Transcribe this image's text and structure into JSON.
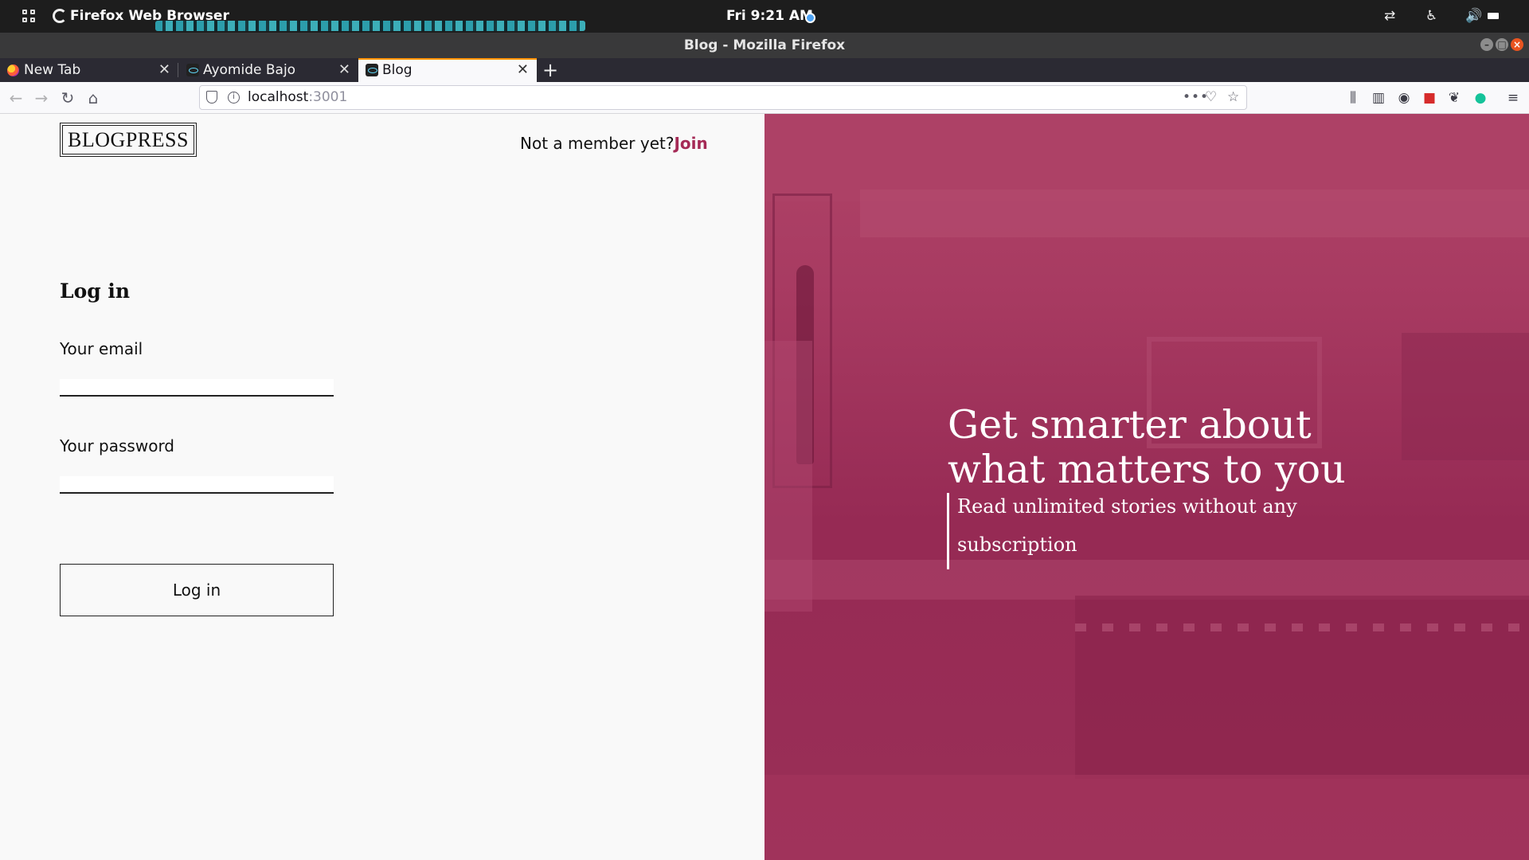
{
  "system": {
    "app_name": "Firefox Web Browser",
    "clock": "Fri  9:21 AM"
  },
  "window": {
    "title": "Blog - Mozilla Firefox"
  },
  "tabs": [
    {
      "label": "New Tab",
      "icon": "firefox-icon",
      "active": false
    },
    {
      "label": "Ayomide Bajo",
      "icon": "react-icon",
      "active": false
    },
    {
      "label": "Blog",
      "icon": "react-icon",
      "active": true
    }
  ],
  "urlbar": {
    "host": "localhost",
    "port": ":3001"
  },
  "header": {
    "logo": "BLOGPRESS",
    "member_prompt": "Not a member yet?",
    "join_link": "Join"
  },
  "form": {
    "title": "Log in",
    "email_label": "Your email",
    "email_value": "",
    "password_label": "Your password",
    "password_value": "",
    "submit_label": "Log in"
  },
  "hero": {
    "headline": "Get smarter about what matters to you",
    "subline": "Read unlimited stories without any subscription"
  },
  "colors": {
    "accent": "#a52a56",
    "hero_overlay": "#a6365c"
  }
}
